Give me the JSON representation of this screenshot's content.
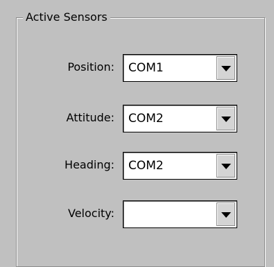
{
  "group": {
    "title": "Active Sensors"
  },
  "rows": [
    {
      "label": "Position:",
      "value": "COM1"
    },
    {
      "label": "Attitude:",
      "value": "COM2"
    },
    {
      "label": "Heading:",
      "value": "COM2"
    },
    {
      "label": "Velocity:",
      "value": ""
    }
  ],
  "icons": {
    "dropdown": "chevron-down-icon"
  },
  "colors": {
    "background": "#c0c0c0",
    "field": "#ffffff",
    "text": "#000000"
  }
}
